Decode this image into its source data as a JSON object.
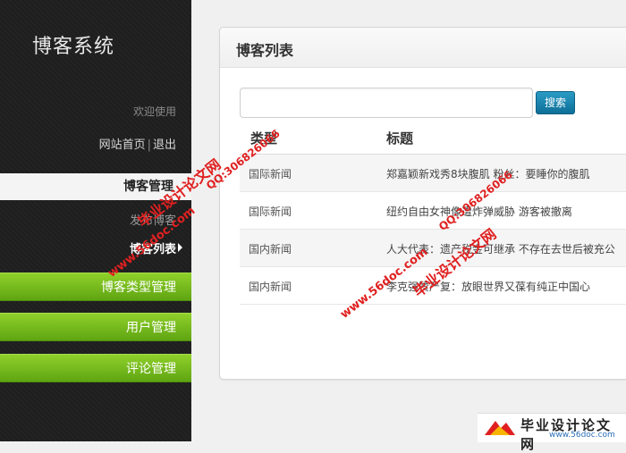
{
  "sidebar": {
    "brand": "博客系统",
    "welcome": "欢迎使用",
    "home_link": "网站首页",
    "separator": "|",
    "logout_link": "退出",
    "blog_manage": "博客管理",
    "sub_items": [
      "发布博客",
      "博客列表"
    ],
    "menu": [
      "博客类型管理",
      "用户管理",
      "评论管理"
    ]
  },
  "main": {
    "title": "博客列表",
    "search_placeholder": "",
    "search_button": "搜索",
    "columns": [
      "类型",
      "标题"
    ],
    "rows": [
      {
        "type": "国际新闻",
        "title": "郑嘉颖新戏秀8块腹肌 粉丝：要睡你的腹肌"
      },
      {
        "type": "国际新闻",
        "title": "纽约自由女神像遭炸弹威胁 游客被撤离"
      },
      {
        "type": "国内新闻",
        "title": "人大代表：遗产税金可继承 不存在去世后被充公"
      },
      {
        "type": "国内新闻",
        "title": "李克强赞严复：放眼世界又葆有纯正中国心"
      }
    ]
  },
  "watermark": {
    "site_cn": "毕业设计论文网",
    "url": "www.56doc.com",
    "qq": "QQ:306826066",
    "logo_url": "www.56doc.com"
  },
  "colors": {
    "accent_green": "#6cb51c",
    "sidebar_bg": "#1e1e1e",
    "button_blue": "#1a86b0",
    "watermark": "#e02020"
  }
}
